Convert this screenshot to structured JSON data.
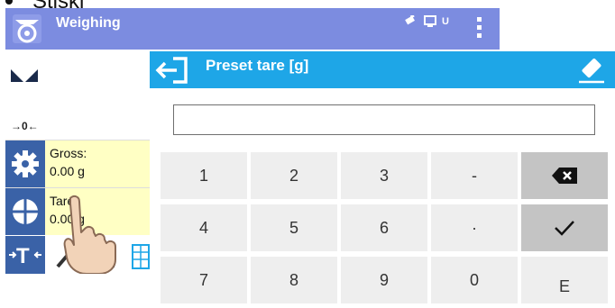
{
  "doc_fragment": {
    "text": "Stiskl"
  },
  "header": {
    "title": "Weighing",
    "usb_label": "U",
    "icons": [
      "scale-app-icon",
      "usb-stick-icon",
      "monitor-icon",
      "menu-dots-icon"
    ],
    "color": "#7c8ce0"
  },
  "indicators": {
    "stability": "stable-indicator-icon",
    "zero": "→0←"
  },
  "info": [
    {
      "label": "Gross:",
      "value": "0.00 g",
      "icon": "gear-icon"
    },
    {
      "label": "Tare:",
      "value": "0.00 g",
      "icon": "tare-icon"
    }
  ],
  "bottom_icons": [
    "tare-function-icon",
    "wrench-icon",
    "container-icon",
    "table-icon"
  ],
  "dialog": {
    "title": "Preset tare [g]",
    "value": "",
    "header_color": "#1ea6e7",
    "keys": [
      [
        "1",
        "2",
        "3",
        "-",
        "⌫"
      ],
      [
        "4",
        "5",
        "6",
        "·",
        "✓"
      ],
      [
        "7",
        "8",
        "9",
        "0",
        "E"
      ]
    ]
  },
  "overlay": {
    "hand": "pointing-hand-icon"
  }
}
